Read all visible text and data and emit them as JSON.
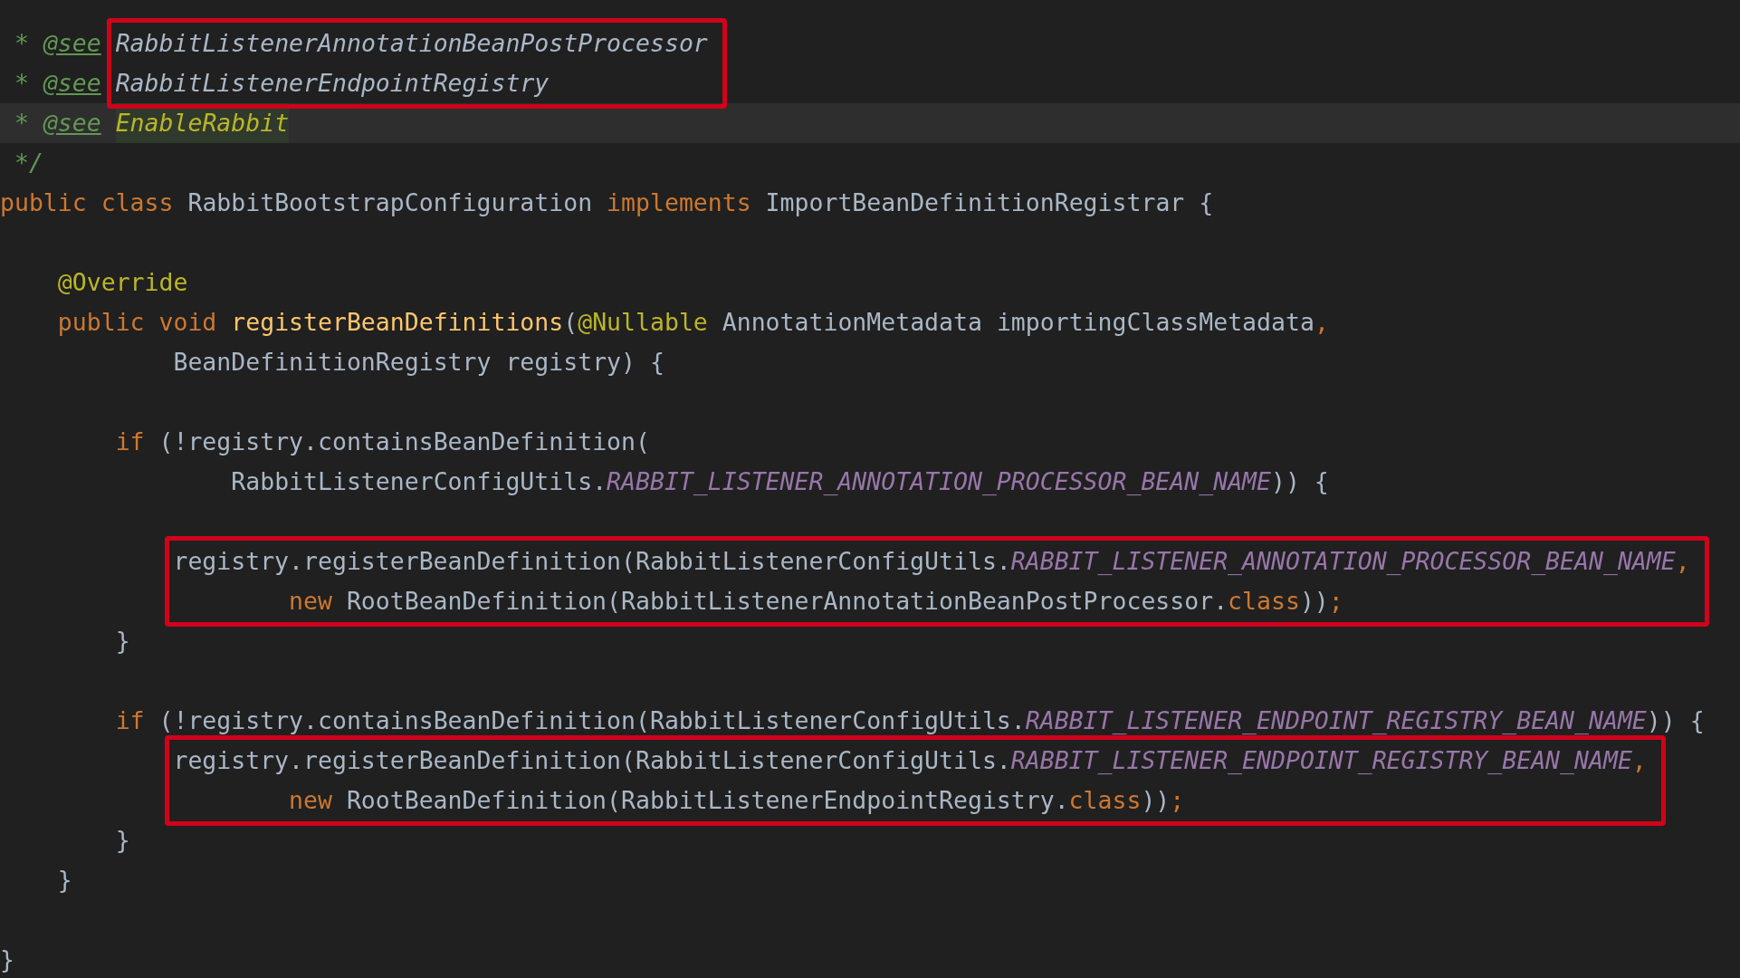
{
  "editor": {
    "blocks": [
      {
        "kind": "frame",
        "lines": [
          {
            "prefix": [
              {
                "kind": "comment",
                "text": "* "
              },
              {
                "kind": "doc-tag",
                "text": "@see"
              }
            ],
            "tokens": [
              {
                "kind": "doc-ref",
                "text": "RabbitListenerAnnotationBeanPostProcessor"
              }
            ]
          },
          {
            "prefix": [
              {
                "kind": "comment",
                "text": "* "
              },
              {
                "kind": "doc-tag",
                "text": "@see"
              }
            ],
            "tokens": [
              {
                "kind": "doc-ref",
                "text": "RabbitListenerEndpointRegistry"
              }
            ]
          }
        ]
      },
      {
        "kind": "line",
        "current": true,
        "tokens": [
          {
            "kind": "comment",
            "text": " * "
          },
          {
            "kind": "doc-tag",
            "text": "@see"
          },
          {
            "kind": "doc-ref-marked",
            "text": "EnableRabbit"
          }
        ]
      },
      {
        "kind": "line",
        "current": false,
        "tokens": [
          {
            "kind": "comment",
            "text": " */"
          }
        ]
      },
      {
        "kind": "line",
        "current": false,
        "tokens": [
          {
            "kind": "keyword",
            "text": "public class "
          },
          {
            "kind": "plain",
            "text": "RabbitBootstrapConfiguration "
          },
          {
            "kind": "keyword",
            "text": "implements "
          },
          {
            "kind": "plain",
            "text": "ImportBeanDefinitionRegistrar {"
          }
        ]
      },
      {
        "kind": "blank"
      },
      {
        "kind": "line",
        "current": false,
        "tokens": [
          {
            "kind": "annotation",
            "text": "    @Override"
          }
        ]
      },
      {
        "kind": "line",
        "current": false,
        "tokens": [
          {
            "kind": "keyword",
            "text": "    public void "
          },
          {
            "kind": "method",
            "text": "registerBeanDefinitions"
          },
          {
            "kind": "plain",
            "text": "("
          },
          {
            "kind": "annotation",
            "text": "@Nullable "
          },
          {
            "kind": "plain",
            "text": "AnnotationMetadata importingClassMetadata"
          },
          {
            "kind": "keyword",
            "text": ","
          }
        ]
      },
      {
        "kind": "line",
        "current": false,
        "tokens": [
          {
            "kind": "plain",
            "text": "            BeanDefinitionRegistry registry) {"
          }
        ]
      },
      {
        "kind": "blank"
      },
      {
        "kind": "line",
        "current": false,
        "tokens": [
          {
            "kind": "keyword",
            "text": "        if "
          },
          {
            "kind": "plain",
            "text": "(!registry.containsBeanDefinition("
          }
        ]
      },
      {
        "kind": "line",
        "current": false,
        "tokens": [
          {
            "kind": "plain",
            "text": "                RabbitListenerConfigUtils."
          },
          {
            "kind": "constant",
            "text": "RABBIT_LISTENER_ANNOTATION_PROCESSOR_BEAN_NAME"
          },
          {
            "kind": "plain",
            "text": ")) {"
          }
        ]
      },
      {
        "kind": "blank"
      },
      {
        "kind": "frame",
        "lines": [
          {
            "tokens": [
              {
                "kind": "plain",
                "text": "registry.registerBeanDefinition(RabbitListenerConfigUtils."
              },
              {
                "kind": "constant",
                "text": "RABBIT_LISTENER_ANNOTATION_PROCESSOR_BEAN_NAME"
              },
              {
                "kind": "keyword",
                "text": ","
              }
            ]
          },
          {
            "tokens": [
              {
                "kind": "keyword",
                "text": "        new "
              },
              {
                "kind": "plain",
                "text": "RootBeanDefinition(RabbitListenerAnnotationBeanPostProcessor."
              },
              {
                "kind": "keyword",
                "text": "class"
              },
              {
                "kind": "plain",
                "text": "))"
              },
              {
                "kind": "keyword",
                "text": ";"
              }
            ]
          }
        ]
      },
      {
        "kind": "line",
        "current": false,
        "tokens": [
          {
            "kind": "plain",
            "text": "        }"
          }
        ]
      },
      {
        "kind": "blank"
      },
      {
        "kind": "line",
        "current": false,
        "tokens": [
          {
            "kind": "keyword",
            "text": "        if "
          },
          {
            "kind": "plain",
            "text": "(!registry.containsBeanDefinition(RabbitListenerConfigUtils."
          },
          {
            "kind": "constant",
            "text": "RABBIT_LISTENER_ENDPOINT_REGISTRY_BEAN_NAME"
          },
          {
            "kind": "plain",
            "text": ")) {"
          }
        ]
      },
      {
        "kind": "frame",
        "lines": [
          {
            "tokens": [
              {
                "kind": "plain",
                "text": "registry.registerBeanDefinition(RabbitListenerConfigUtils."
              },
              {
                "kind": "constant",
                "text": "RABBIT_LISTENER_ENDPOINT_REGISTRY_BEAN_NAME"
              },
              {
                "kind": "keyword",
                "text": ","
              }
            ]
          },
          {
            "tokens": [
              {
                "kind": "keyword",
                "text": "        new "
              },
              {
                "kind": "plain",
                "text": "RootBeanDefinition(RabbitListenerEndpointRegistry."
              },
              {
                "kind": "keyword",
                "text": "class"
              },
              {
                "kind": "plain",
                "text": "))"
              },
              {
                "kind": "keyword",
                "text": ";"
              }
            ]
          }
        ]
      },
      {
        "kind": "line",
        "current": false,
        "tokens": [
          {
            "kind": "plain",
            "text": "        }"
          }
        ]
      },
      {
        "kind": "line",
        "current": false,
        "tokens": [
          {
            "kind": "plain",
            "text": "    }"
          }
        ]
      },
      {
        "kind": "blank"
      },
      {
        "kind": "line",
        "current": false,
        "tokens": [
          {
            "kind": "plain",
            "text": "}"
          }
        ]
      }
    ]
  }
}
